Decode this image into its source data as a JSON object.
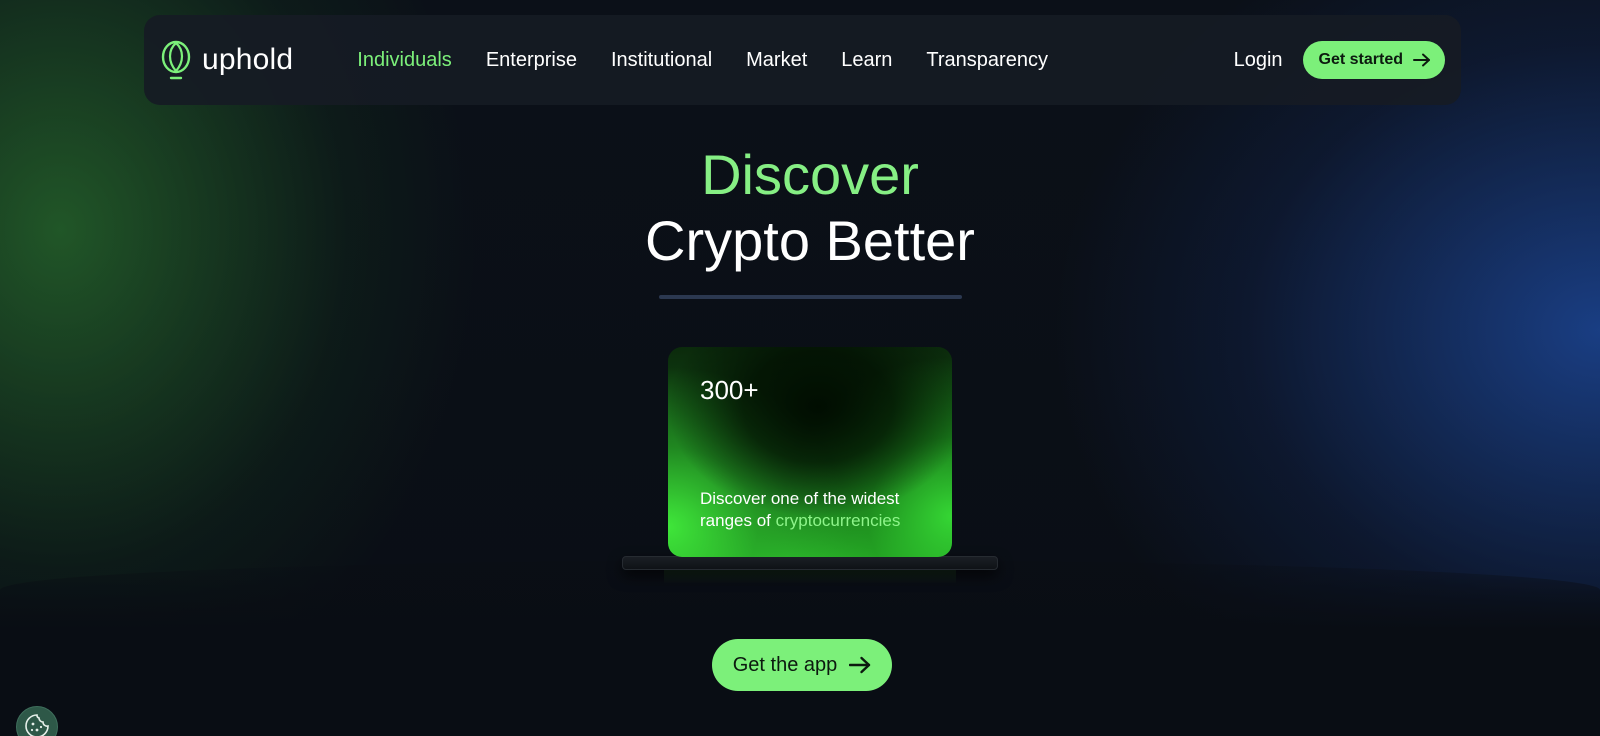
{
  "nav": {
    "brand": "uphold",
    "items": [
      {
        "label": "Individuals",
        "active": true
      },
      {
        "label": "Enterprise",
        "active": false
      },
      {
        "label": "Institutional",
        "active": false
      },
      {
        "label": "Market",
        "active": false
      },
      {
        "label": "Learn",
        "active": false
      },
      {
        "label": "Transparency",
        "active": false
      }
    ],
    "login_label": "Login",
    "cta_label": "Get started"
  },
  "hero": {
    "line1": "Discover",
    "line2": "Crypto Better"
  },
  "card": {
    "count": "300+",
    "desc_prefix": "Discover one of the widest ranges of ",
    "desc_highlight": "cryptocurrencies"
  },
  "cta": {
    "label": "Get the app"
  },
  "icons": {
    "logo": "uphold-logo-icon",
    "arrow": "arrow-right-icon",
    "cookie": "cookie-icon"
  },
  "colors": {
    "accent": "#7cf07a",
    "background": "#0a0e14",
    "nav_bg": "#161b24"
  }
}
